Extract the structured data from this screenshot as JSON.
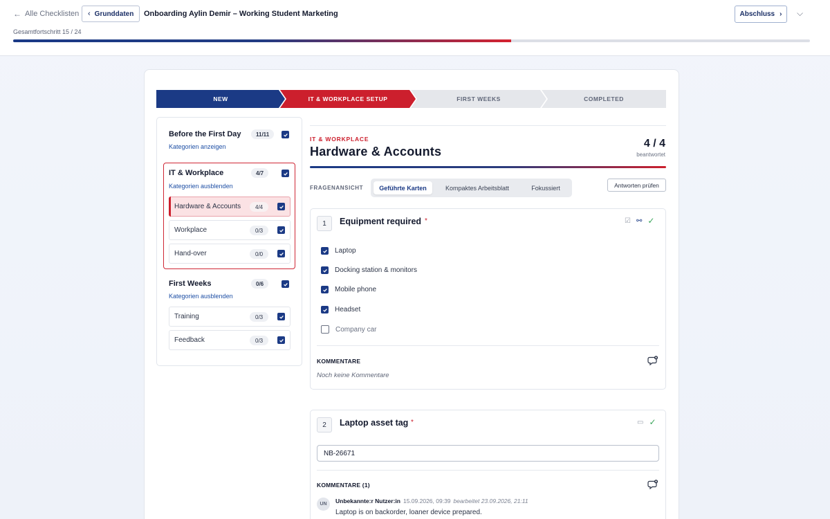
{
  "header": {
    "back_label": "Alle Checklisten",
    "grunddaten_label": "Grunddaten",
    "title": "Onboarding Aylin Demir – Working Student Marketing",
    "abschluss_label": "Abschluss",
    "progress_label": "Gesamtfortschritt 15 / 24",
    "progress_fraction": 0.625
  },
  "stepper": {
    "steps": [
      "NEW",
      "IT & WORKPLACE SETUP",
      "FIRST WEEKS",
      "COMPLETED"
    ],
    "active_index": 1
  },
  "sidebar": {
    "categories": [
      {
        "name": "Before the First Day",
        "count": "11/11",
        "link": "Kategorien anzeigen",
        "items": []
      },
      {
        "name": "IT & Workplace",
        "count": "4/7",
        "link": "Kategorien ausblenden",
        "items": [
          {
            "label": "Hardware & Accounts",
            "count": "4/4",
            "active": true
          },
          {
            "label": "Workplace",
            "count": "0/3"
          },
          {
            "label": "Hand-over",
            "count": "0/0"
          }
        ]
      },
      {
        "name": "First Weeks",
        "count": "0/6",
        "link": "Kategorien ausblenden",
        "items": [
          {
            "label": "Training",
            "count": "0/3"
          },
          {
            "label": "Feedback",
            "count": "0/3"
          }
        ]
      }
    ]
  },
  "section": {
    "overline": "IT & WORKPLACE",
    "title": "Hardware & Accounts",
    "score": "4 / 4",
    "score_sub": "beantwortet"
  },
  "view": {
    "label": "FRAGENANSICHT",
    "tabs": [
      "Geführte Karten",
      "Kompaktes Arbeitsblatt",
      "Fokussiert"
    ],
    "active_tab": 0,
    "check_button": "Antworten prüfen"
  },
  "questions": [
    {
      "number": "1",
      "title": "Equipment required",
      "required_mark": "*",
      "options": [
        {
          "label": "Laptop",
          "checked": true
        },
        {
          "label": "Docking station & monitors",
          "checked": true
        },
        {
          "label": "Mobile phone",
          "checked": true
        },
        {
          "label": "Headset",
          "checked": true
        },
        {
          "label": "Company car",
          "checked": false
        }
      ],
      "comments_label": "KOMMENTARE",
      "comments_empty": "Noch keine Kommentare"
    },
    {
      "number": "2",
      "title": "Laptop asset tag",
      "required_mark": "*",
      "value": "NB-26671",
      "comments_label": "KOMMENTARE (1)",
      "comment": {
        "initials": "UN",
        "author": "Unbekannte:r Nutzer:in",
        "timestamp": "15.09.2026, 09:39",
        "edited": "bearbeitet 23.09.2026, 21:11",
        "text": "Laptop is on backorder, loaner device prepared."
      }
    }
  ],
  "colors": {
    "primary": "#1b3a85",
    "accent": "#cc1f2d",
    "success": "#3aa55a"
  }
}
